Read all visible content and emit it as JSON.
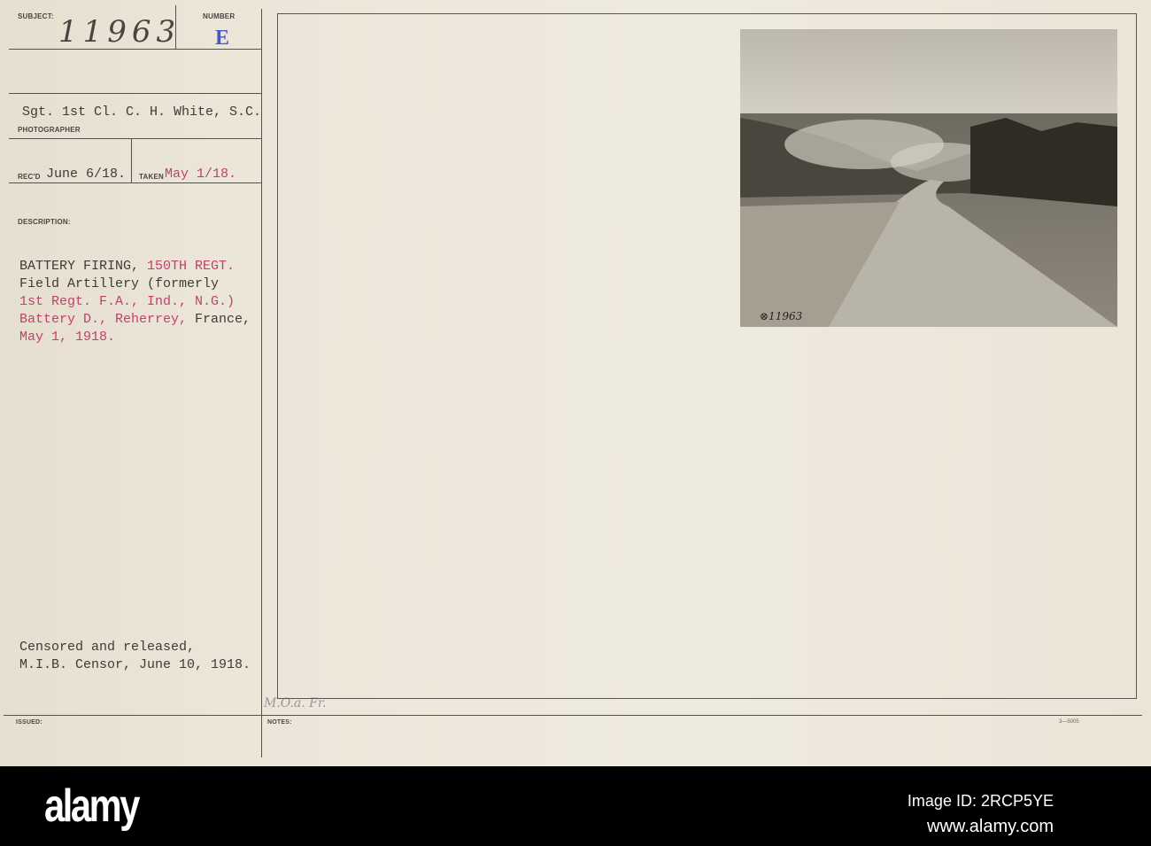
{
  "card": {
    "subject_label": "SUBJECT:",
    "number_label": "NUMBER",
    "subject_value": "11963",
    "number_value": "E",
    "photographer": "Sgt. 1st Cl. C. H. White, S.C.",
    "photographer_label": "PHOTOGRAPHER",
    "recd_label": "REC'D",
    "recd_value": "June 6/18.",
    "taken_label": "TAKEN",
    "taken_value": "May 1/18.",
    "description_label": "DESCRIPTION:",
    "description": {
      "l1a": "BATTERY FIRING, ",
      "l1b": "150TH REGT.",
      "l2": "Field Artillery (formerly",
      "l3": "1st Regt. F.A., Ind., N.G.)",
      "l4a": "Battery D., Reherrey, ",
      "l4b": "France,",
      "l5": "May 1, 1918."
    },
    "censor_l1": "Censored and released,",
    "censor_l2": "M.I.B. Censor, June 10, 1918.",
    "issued_label": "ISSUED:",
    "notes_label": "NOTES:",
    "form_number": "3—5005",
    "pencil_note": "M.O.a. Fr.",
    "photo_caption": "⊗11963"
  },
  "footer": {
    "logo": "alamy",
    "image_id": "Image ID: 2RCP5YE",
    "url": "www.alamy.com"
  }
}
